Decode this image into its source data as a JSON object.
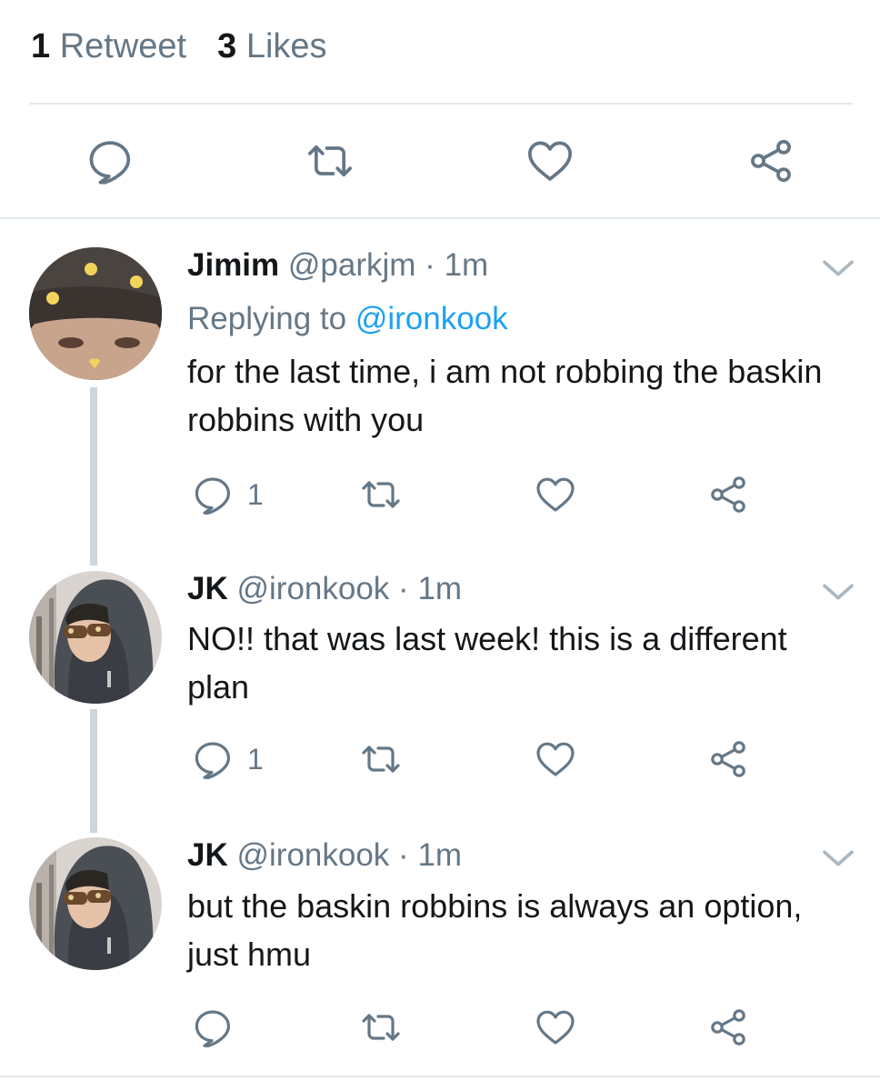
{
  "stats": {
    "retweet_count": "1",
    "retweet_label": "Retweet",
    "like_count": "3",
    "like_label": "Likes"
  },
  "main_actions": [
    "reply-icon",
    "retweet-icon",
    "like-icon",
    "share-icon"
  ],
  "colors": {
    "icon": "#657786",
    "mention": "#1da1f2",
    "divider": "#e1e8ed",
    "thread_line": "#ccd6dd"
  },
  "replies": [
    {
      "name": "Jimim",
      "handle": "@parkjm",
      "sep": "·",
      "time": "1m",
      "replying_label": "Replying to",
      "replying_to": "@ironkook",
      "text": "for the last time, i am not robbing the baskin robbins with you",
      "reply_count": "1"
    },
    {
      "name": "JK",
      "handle": "@ironkook",
      "sep": "·",
      "time": "1m",
      "text": "NO!! that was last week! this is a different plan",
      "reply_count": "1"
    },
    {
      "name": "JK",
      "handle": "@ironkook",
      "sep": "·",
      "time": "1m",
      "text": "but the baskin robbins is always an option, just hmu",
      "reply_count": ""
    }
  ]
}
